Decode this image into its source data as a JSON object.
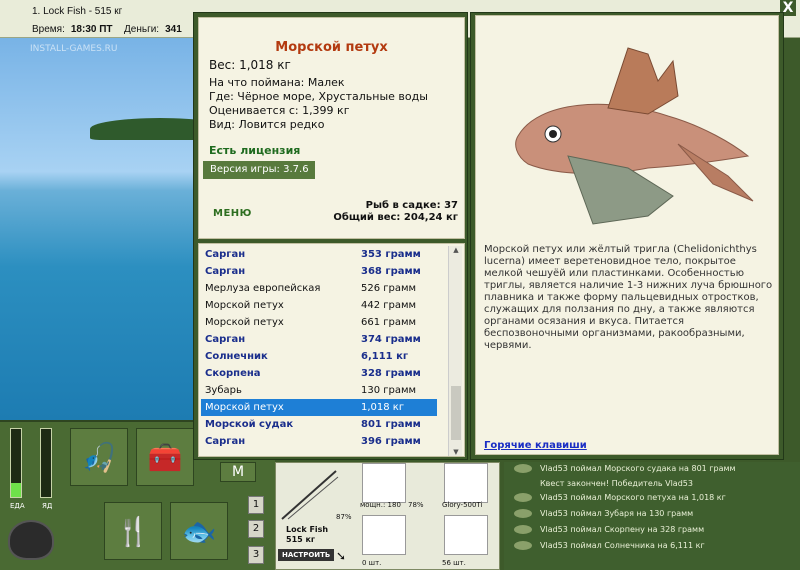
{
  "topbar": {
    "window_title": "1. Lock Fish - 515 кг",
    "time_label": "Время:",
    "time_value": "18:30 ПТ",
    "money_label": "Деньги:",
    "money_value": "341",
    "close": "X"
  },
  "scene": {
    "watermark": "INSTALL-GAMES.RU"
  },
  "gauges": {
    "food_label": "ЕДА",
    "poison_label": "ЯД",
    "food_level": 0.2,
    "poison_level": 0.0
  },
  "bottom_buttons": {
    "page_1": "1",
    "page_2": "2",
    "page_3": "3"
  },
  "inventory": {
    "rod_name": "Lock Fish",
    "rod_weight": "515 кг",
    "rod_pct": "87%",
    "adjust_button": "НАСТРОИТЬ",
    "reel_label": "мощн.: 180",
    "reel_pct": "78%",
    "line_label": "Glory-500Ti",
    "hooks_count": "0 шт.",
    "lures_count": "56 шт."
  },
  "log": {
    "items": [
      "Vlad53 поймал Морского судака на 801 грамм",
      "Квест закончен! Победитель Vlad53",
      "Vlad53 поймал Морского петуха на 1,018 кг",
      "Vlad53 поймал Зубаря на 130 грамм",
      "Vlad53 поймал Скорпену на 328 грамм",
      "Vlad53 поймал Солнечника на 6,111 кг"
    ]
  },
  "fish_info": {
    "title": "Морской петух",
    "weight": "Вес: 1,018 кг",
    "bait": "На что поймана: Малек",
    "where": "Где: Чёрное море, Хрустальные воды",
    "valued_from": "Оценивается с: 1,399 кг",
    "kind": "Вид: Ловится редко",
    "license": "Есть лицензия",
    "version_label": "Версия игры:",
    "version_value": "3.7.6",
    "menu": "МЕНЮ",
    "cage_count": "Рыб в садке: 37",
    "total_weight": "Общий вес: 204,24 кг"
  },
  "catch_list": [
    {
      "name": "Сарган",
      "weight": "353 грамм",
      "rare": true,
      "selected": false
    },
    {
      "name": "Сарган",
      "weight": "368 грамм",
      "rare": true,
      "selected": false
    },
    {
      "name": "Мерлуза европейская",
      "weight": "526 грамм",
      "rare": false,
      "selected": false
    },
    {
      "name": "Морской петух",
      "weight": "442 грамм",
      "rare": false,
      "selected": false
    },
    {
      "name": "Морской петух",
      "weight": "661 грамм",
      "rare": false,
      "selected": false
    },
    {
      "name": "Сарган",
      "weight": "374 грамм",
      "rare": true,
      "selected": false
    },
    {
      "name": "Солнечник",
      "weight": "6,111 кг",
      "rare": true,
      "selected": false
    },
    {
      "name": "Скорпена",
      "weight": "328 грамм",
      "rare": true,
      "selected": false
    },
    {
      "name": "Зубарь",
      "weight": "130 грамм",
      "rare": false,
      "selected": false
    },
    {
      "name": "Морской петух",
      "weight": "1,018 кг",
      "rare": false,
      "selected": true
    },
    {
      "name": "Морской судак",
      "weight": "801 грамм",
      "rare": true,
      "selected": false
    },
    {
      "name": "Сарган",
      "weight": "396 грамм",
      "rare": true,
      "selected": false
    }
  ],
  "description": {
    "text": "Морской петух или жёлтый тригла (Chelidonichthys lucerna) имеет веретеновидное тело, покрытое мелкой чешуёй или пластинками. Особенностью триглы, является наличие 1-3 нижних луча брюшного плавника и также форму пальцевидных отростков, служащих для ползания по дну, а также являются органами осязания и вкуса. Питается беспозвоночными организмами, ракообразными, червями.",
    "hotkeys_link": "Горячие клавиши"
  }
}
